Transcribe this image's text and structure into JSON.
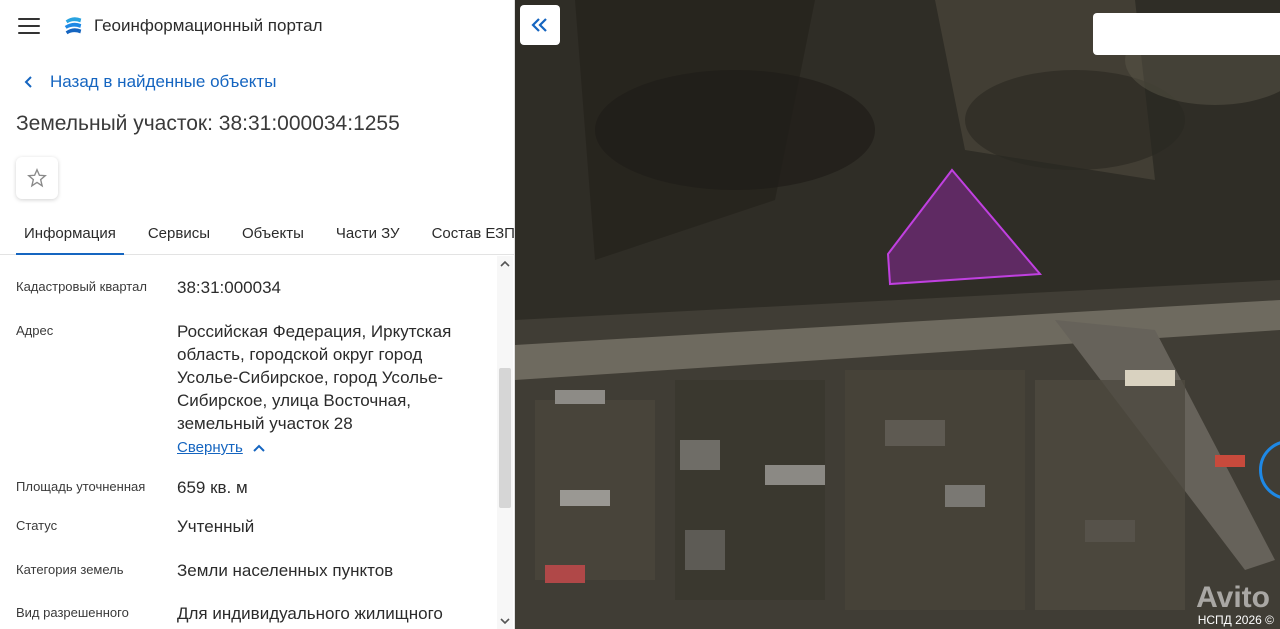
{
  "header": {
    "app_title": "Геоинформационный портал"
  },
  "nav": {
    "back_label": "Назад в найденные объекты"
  },
  "object": {
    "title": "Земельный участок: 38:31:000034:1255"
  },
  "tabs": [
    {
      "label": "Информация",
      "active": true
    },
    {
      "label": "Сервисы"
    },
    {
      "label": "Объекты"
    },
    {
      "label": "Части ЗУ"
    },
    {
      "label": "Состав ЕЗП"
    }
  ],
  "info": {
    "cadastral_quarter": {
      "label": "Кадастровый квартал",
      "value": "38:31:000034"
    },
    "address": {
      "label": "Адрес",
      "value": "Российская Федерация, Иркутская область, городской округ город Усолье-Сибирское, город Усолье-Сибирское, улица Восточная, земельный участок 28",
      "collapse_label": "Свернуть"
    },
    "area": {
      "label": "Площадь уточненная",
      "value": "659 кв. м"
    },
    "status": {
      "label": "Статус",
      "value": "Учтенный"
    },
    "land_category": {
      "label": "Категория земель",
      "value": "Земли населенных пунктов"
    },
    "permitted_use": {
      "label": "Вид разрешенного",
      "value": "Для индивидуального жилищного"
    }
  },
  "map": {
    "attribution": "НСПД 2026 ©",
    "watermark": "Avito"
  },
  "colors": {
    "accent": "#1565c0",
    "parcel": "#9c27b0"
  }
}
